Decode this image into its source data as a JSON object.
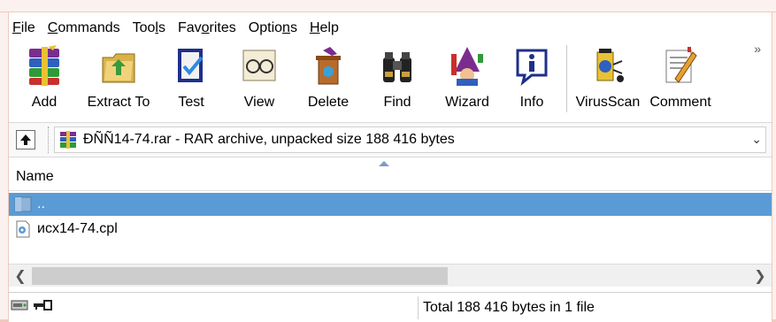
{
  "menu": [
    {
      "pre": "",
      "u": "F",
      "post": "ile"
    },
    {
      "pre": "",
      "u": "C",
      "post": "ommands"
    },
    {
      "pre": "Too",
      "u": "l",
      "post": "s"
    },
    {
      "pre": "Fav",
      "u": "o",
      "post": "rites"
    },
    {
      "pre": "Optio",
      "u": "n",
      "post": "s"
    },
    {
      "pre": "",
      "u": "H",
      "post": "elp"
    }
  ],
  "toolbar": {
    "add": "Add",
    "extract": "Extract To",
    "test": "Test",
    "view": "View",
    "delete": "Delete",
    "find": "Find",
    "wizard": "Wizard",
    "info": "Info",
    "virusscan": "VirusScan",
    "comment": "Comment",
    "overflow": "»"
  },
  "path": {
    "text": "ÐÑÑ14-74.rar - RAR archive, unpacked size 188 416 bytes"
  },
  "list": {
    "column_name": "Name",
    "rows": [
      {
        "name": "..",
        "selected": true
      },
      {
        "name": "исх14-74.cpl",
        "selected": false
      }
    ]
  },
  "status": {
    "text": "Total 188 416 bytes in 1 file"
  },
  "icons": {
    "add": "archive-books-icon",
    "extract": "extract-folder-icon",
    "test": "clipboard-check-icon",
    "view": "glasses-icon",
    "delete": "trash-icon",
    "find": "binoculars-icon",
    "wizard": "wizard-icon",
    "info": "info-icon",
    "virusscan": "virus-scan-icon",
    "comment": "comment-pencil-icon"
  },
  "colors": {
    "selection": "#5b9bd5",
    "frame": "#f1c9bd"
  }
}
